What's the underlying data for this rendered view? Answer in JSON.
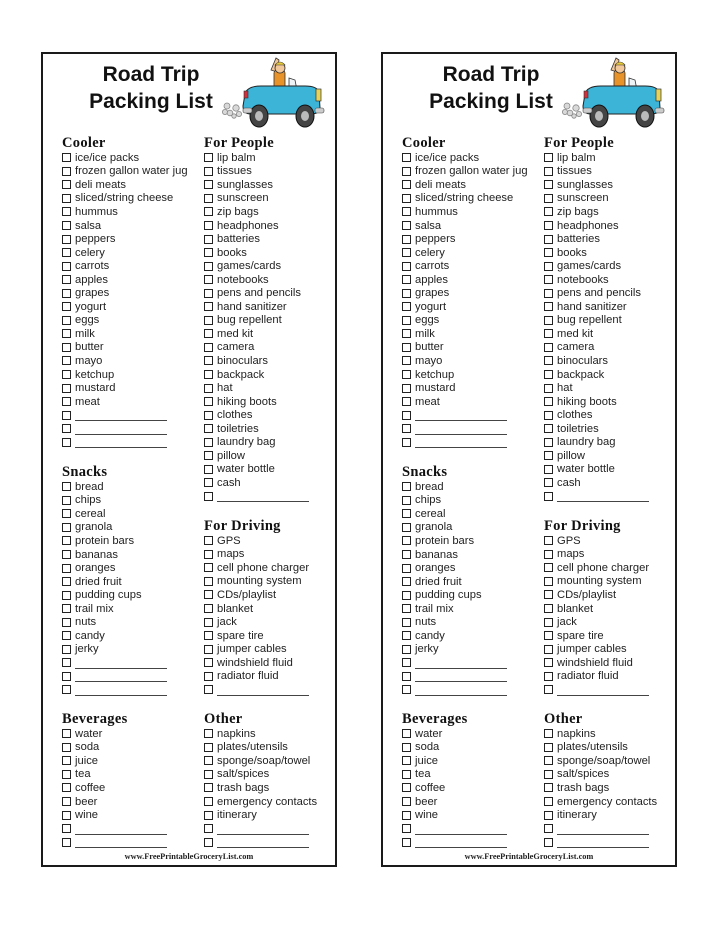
{
  "title_line1": "Road Trip",
  "title_line2": "Packing List",
  "footer": "www.FreePrintableGroceryList.com",
  "illustration": "car-with-waving-driver-icon",
  "colors": {
    "car_body": "#3cb4d8",
    "border": "#1a1a1a",
    "text": "#222222"
  },
  "cards": [
    {
      "sections": {
        "cooler": {
          "title": "Cooler",
          "items": [
            "ice/ice packs",
            "frozen gallon water jug",
            "deli meats",
            "sliced/string cheese",
            "hummus",
            "salsa",
            "peppers",
            "celery",
            "carrots",
            "apples",
            "grapes",
            "yogurt",
            "eggs",
            "milk",
            "butter",
            "mayo",
            "ketchup",
            "mustard",
            "meat"
          ],
          "blanks": 3
        },
        "snacks": {
          "title": "Snacks",
          "items": [
            "bread",
            "chips",
            "cereal",
            "granola",
            "protein bars",
            "bananas",
            "oranges",
            "dried fruit",
            "pudding cups",
            "trail mix",
            "nuts",
            "candy",
            "jerky"
          ],
          "blanks": 3
        },
        "beverages": {
          "title": "Beverages",
          "items": [
            "water",
            "soda",
            "juice",
            "tea",
            "coffee",
            "beer",
            "wine"
          ],
          "blanks": 2
        },
        "for_people": {
          "title": "For People",
          "items": [
            "lip balm",
            "tissues",
            "sunglasses",
            "sunscreen",
            "zip bags",
            "headphones",
            "batteries",
            "books",
            "games/cards",
            "notebooks",
            "pens and pencils",
            "hand sanitizer",
            "bug repellent",
            "med kit",
            "camera",
            "binoculars",
            "backpack",
            "hat",
            "hiking boots",
            "clothes",
            "toiletries",
            "laundry bag",
            "pillow",
            "water bottle",
            "cash"
          ],
          "blanks": 1
        },
        "for_driving": {
          "title": "For Driving",
          "items": [
            "GPS",
            "maps",
            "cell phone charger",
            "mounting system",
            "CDs/playlist",
            "blanket",
            "jack",
            "spare tire",
            "jumper cables",
            "windshield fluid",
            "radiator fluid"
          ],
          "blanks": 1
        },
        "other": {
          "title": "Other",
          "items": [
            "napkins",
            "plates/utensils",
            "sponge/soap/towel",
            "salt/spices",
            "trash bags",
            "emergency contacts",
            "itinerary"
          ],
          "blanks": 2
        }
      }
    },
    {
      "sections": {
        "cooler": {
          "title": "Cooler",
          "items": [
            "ice/ice packs",
            "frozen gallon water jug",
            "deli meats",
            "sliced/string cheese",
            "hummus",
            "salsa",
            "peppers",
            "celery",
            "carrots",
            "apples",
            "grapes",
            "yogurt",
            "eggs",
            "milk",
            "butter",
            "mayo",
            "ketchup",
            "mustard",
            "meat"
          ],
          "blanks": 3
        },
        "snacks": {
          "title": "Snacks",
          "items": [
            "bread",
            "chips",
            "cereal",
            "granola",
            "protein bars",
            "bananas",
            "oranges",
            "dried fruit",
            "pudding cups",
            "trail mix",
            "nuts",
            "candy",
            "jerky"
          ],
          "blanks": 3
        },
        "beverages": {
          "title": "Beverages",
          "items": [
            "water",
            "soda",
            "juice",
            "tea",
            "coffee",
            "beer",
            "wine"
          ],
          "blanks": 2
        },
        "for_people": {
          "title": "For People",
          "items": [
            "lip balm",
            "tissues",
            "sunglasses",
            "sunscreen",
            "zip bags",
            "headphones",
            "batteries",
            "books",
            "games/cards",
            "notebooks",
            "pens and pencils",
            "hand sanitizer",
            "bug repellent",
            "med kit",
            "camera",
            "binoculars",
            "backpack",
            "hat",
            "hiking boots",
            "clothes",
            "toiletries",
            "laundry bag",
            "pillow",
            "water bottle",
            "cash"
          ],
          "blanks": 1
        },
        "for_driving": {
          "title": "For Driving",
          "items": [
            "GPS",
            "maps",
            "cell phone charger",
            "mounting system",
            "CDs/playlist",
            "blanket",
            "jack",
            "spare tire",
            "jumper cables",
            "windshield fluid",
            "radiator fluid"
          ],
          "blanks": 1
        },
        "other": {
          "title": "Other",
          "items": [
            "napkins",
            "plates/utensils",
            "sponge/soap/towel",
            "salt/spices",
            "trash bags",
            "emergency contacts",
            "itinerary"
          ],
          "blanks": 2
        }
      }
    }
  ]
}
